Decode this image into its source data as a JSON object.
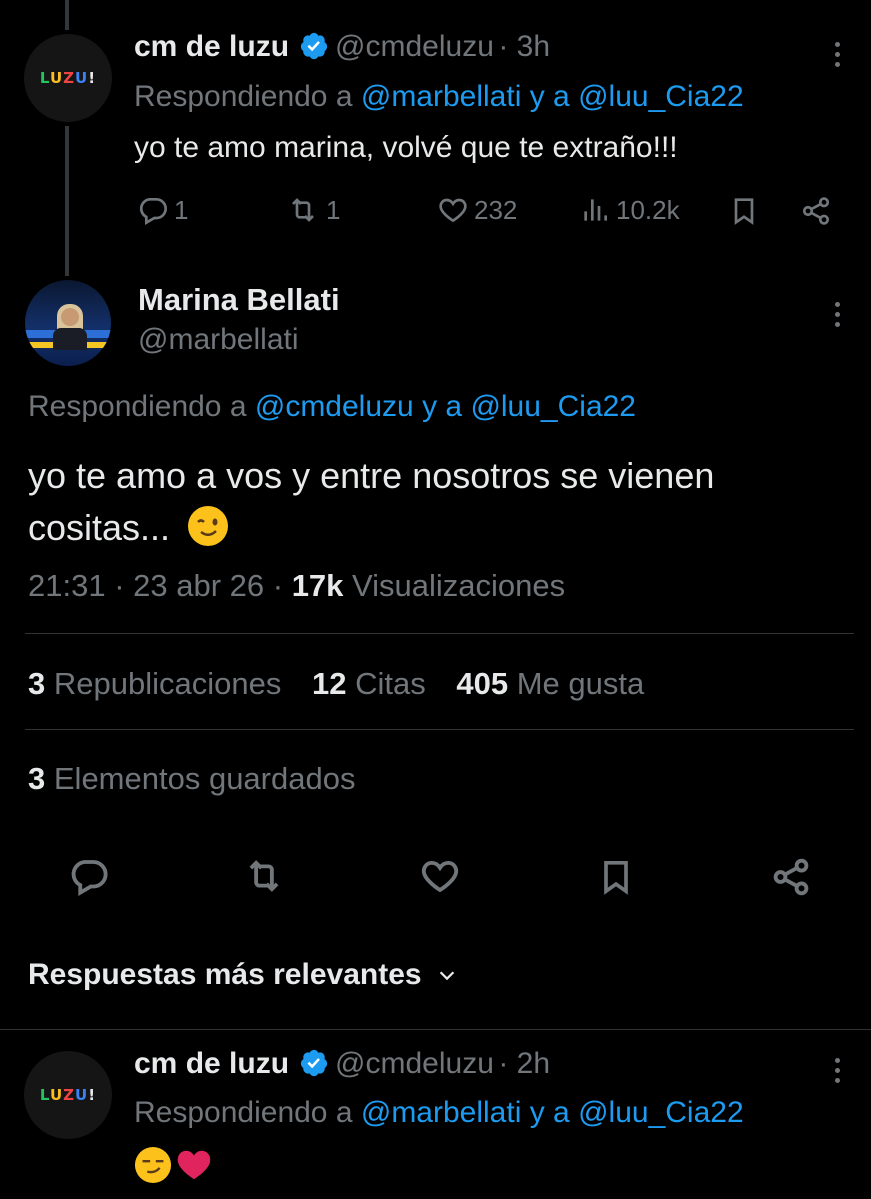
{
  "tweet1": {
    "name": "cm de luzu",
    "handle": "@cmdeluzu",
    "time": "· 3h",
    "avatar_text": "LUZU!",
    "replying_prefix": "Respondiendo a",
    "replying_to_1": "@marbellati",
    "replying_conj": "y a",
    "replying_to_2": "@luu_Cia22",
    "text": "yo te amo marina, volvé que te extraño!!!",
    "replies": "1",
    "reposts": "1",
    "likes": "232",
    "views": "10.2k"
  },
  "main": {
    "name": "Marina Bellati",
    "handle": "@marbellati",
    "replying_prefix": "Respondiendo a",
    "replying_to_1": "@cmdeluzu",
    "replying_conj": "y a",
    "replying_to_2": "@luu_Cia22",
    "text": "yo te amo a vos y entre nosotros se vienen cositas...",
    "timestamp": "21:31 · 23 abr 26 ·",
    "views_count": "17k",
    "views_label": "Visualizaciones",
    "reposts_count": "3",
    "reposts_label": "Republicaciones",
    "quotes_count": "12",
    "quotes_label": "Citas",
    "likes_count": "405",
    "likes_label": "Me gusta",
    "bookmarks_count": "3",
    "bookmarks_label": "Elementos guardados"
  },
  "sort": {
    "label": "Respuestas más relevantes"
  },
  "tweet3": {
    "name": "cm de luzu",
    "handle": "@cmdeluzu",
    "time": "· 2h",
    "avatar_text": "LUZU!",
    "replying_prefix": "Respondiendo a",
    "replying_to_1": "@marbellati",
    "replying_conj": "y a",
    "replying_to_2": "@luu_Cia22"
  },
  "colors": {
    "background": "#000000",
    "link": "#1d9bf0",
    "muted": "#71767b",
    "verified": "#1d9bf0"
  },
  "icons": [
    "verified-badge-icon",
    "reply-icon",
    "repost-icon",
    "like-icon",
    "views-icon",
    "bookmark-icon",
    "share-icon",
    "chevron-down-icon",
    "more-icon"
  ]
}
